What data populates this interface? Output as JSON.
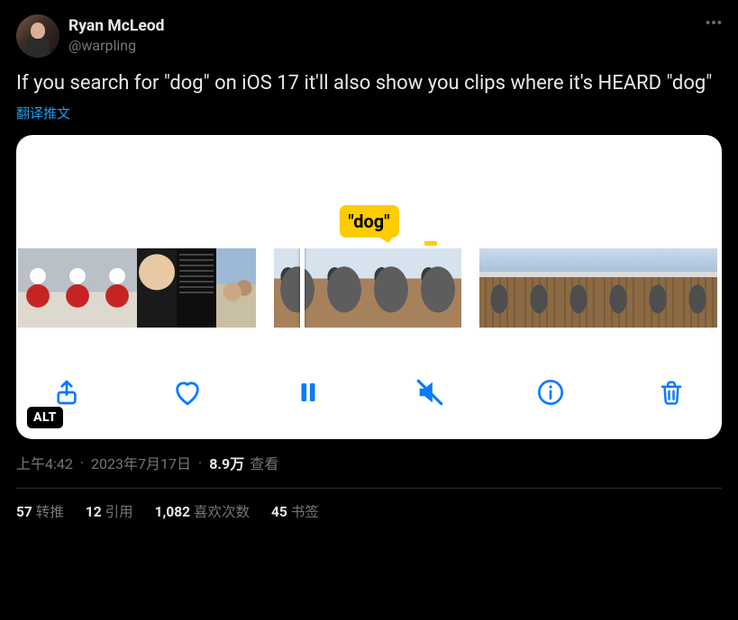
{
  "author": {
    "display_name": "Ryan McLeod",
    "handle": "@warpling"
  },
  "tweet_text": "If you search for \"dog\" on iOS 17 it'll also show you clips where it's HEARD \"dog\"",
  "translate_label": "翻译推文",
  "media": {
    "search_bubble": "\"dog\"",
    "alt_badge": "ALT"
  },
  "meta": {
    "time": "上午4:42",
    "date": "2023年7月17日",
    "views_count": "8.9万",
    "views_label": "查看"
  },
  "engagement": {
    "retweets_count": "57",
    "retweets_label": "转推",
    "quotes_count": "12",
    "quotes_label": "引用",
    "likes_count": "1,082",
    "likes_label": "喜欢次数",
    "bookmarks_count": "45",
    "bookmarks_label": "书签"
  }
}
